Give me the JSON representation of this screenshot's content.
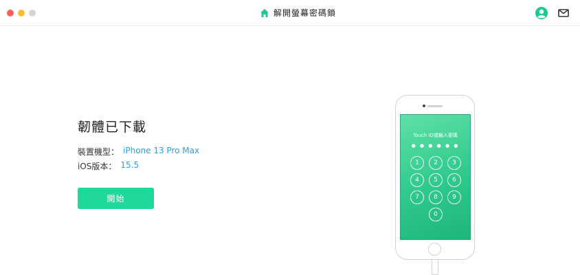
{
  "window": {
    "title": "解開螢幕密碼鎖",
    "home_icon": "home-icon",
    "user_icon": "user-icon",
    "mail_icon": "mail-icon",
    "accent_color": "#1fd99b"
  },
  "main": {
    "heading": "韌體已下載",
    "device_model_label": "裝置機型：",
    "device_model_value": "iPhone 13 Pro Max",
    "ios_version_label": "iOS版本：",
    "ios_version_value": "15.5",
    "start_button_label": "開始"
  },
  "phone": {
    "screen_title": "Touch ID或輸入密碼",
    "passcode_dots": "● ● ● ● ● ●",
    "keys": [
      "1",
      "2",
      "3",
      "4",
      "5",
      "6",
      "7",
      "8",
      "9",
      "0"
    ]
  }
}
